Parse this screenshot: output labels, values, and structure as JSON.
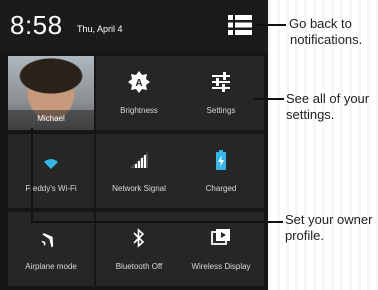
{
  "status_bar": {
    "time": "8:58",
    "date": "Thu, April 4"
  },
  "tiles": {
    "owner": {
      "label": "Michael"
    },
    "brightness": {
      "label": "Brightness",
      "icon": "brightness-auto-icon"
    },
    "settings": {
      "label": "Settings",
      "icon": "settings-sliders-icon"
    },
    "wifi": {
      "label": "Freddy's Wi-Fi",
      "icon": "wifi-icon"
    },
    "network": {
      "label": "Network Signal",
      "icon": "signal-icon"
    },
    "battery": {
      "label": "Charged",
      "icon": "battery-icon",
      "color": "#33b5e5"
    },
    "airplane": {
      "label": "Airplane mode",
      "icon": "airplane-icon"
    },
    "bluetooth": {
      "label": "Bluetooth Off",
      "icon": "bluetooth-icon"
    },
    "display": {
      "label": "Wireless Display",
      "icon": "cast-icon"
    }
  },
  "callouts": {
    "notifications": [
      "Go back to",
      "notifications."
    ],
    "settings": [
      "See all of your",
      "settings."
    ],
    "owner": [
      "Set your owner",
      "profile."
    ]
  },
  "colors": {
    "panel": "#161616",
    "tile": "#262626",
    "accent": "#33b5e5"
  }
}
